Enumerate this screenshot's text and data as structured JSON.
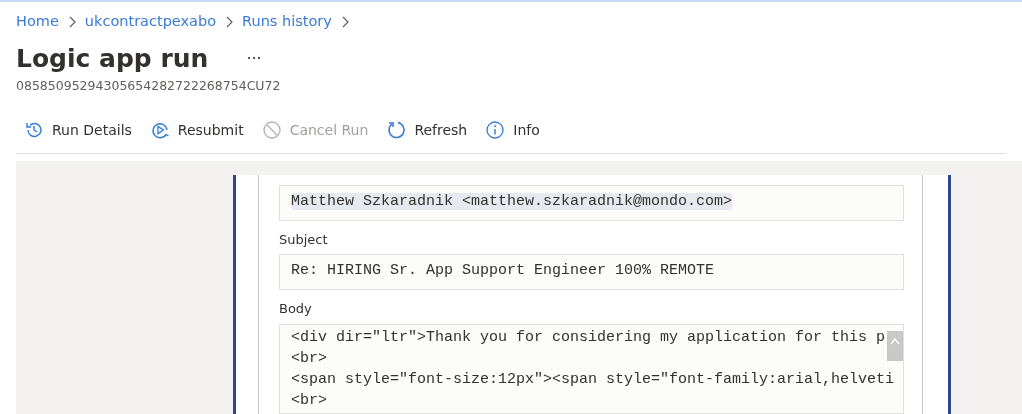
{
  "breadcrumb": [
    {
      "label": "Home"
    },
    {
      "label": "ukcontractpexabo"
    },
    {
      "label": "Runs history"
    }
  ],
  "title": "Logic app run",
  "more": "···",
  "run_id": "08585095294305654282722268754CU72",
  "toolbar": [
    {
      "label": "Run Details",
      "kind": "details",
      "disabled": false
    },
    {
      "label": "Resubmit",
      "kind": "resubmit",
      "disabled": false
    },
    {
      "label": "Cancel Run",
      "kind": "cancel",
      "disabled": true
    },
    {
      "label": "Refresh",
      "kind": "refresh",
      "disabled": false
    },
    {
      "label": "Info",
      "kind": "info",
      "disabled": false
    }
  ],
  "fields": [
    {
      "value": "Matthew Szkaradnik <matthew.szkaradnik@mondo.com>",
      "highlighted": true
    },
    {
      "label": "Subject",
      "value": "Re: HIRING Sr. App Support Engineer 100% REMOTE",
      "highlighted": false
    },
    {
      "label": "Body",
      "lines": [
        "<div dir=\"ltr\">Thank you for considering my application for this p",
        "<br>",
        "<span style=\"font-size:12px\"><span style=\"font-family:arial,helveti",
        "<br>"
      ]
    }
  ]
}
